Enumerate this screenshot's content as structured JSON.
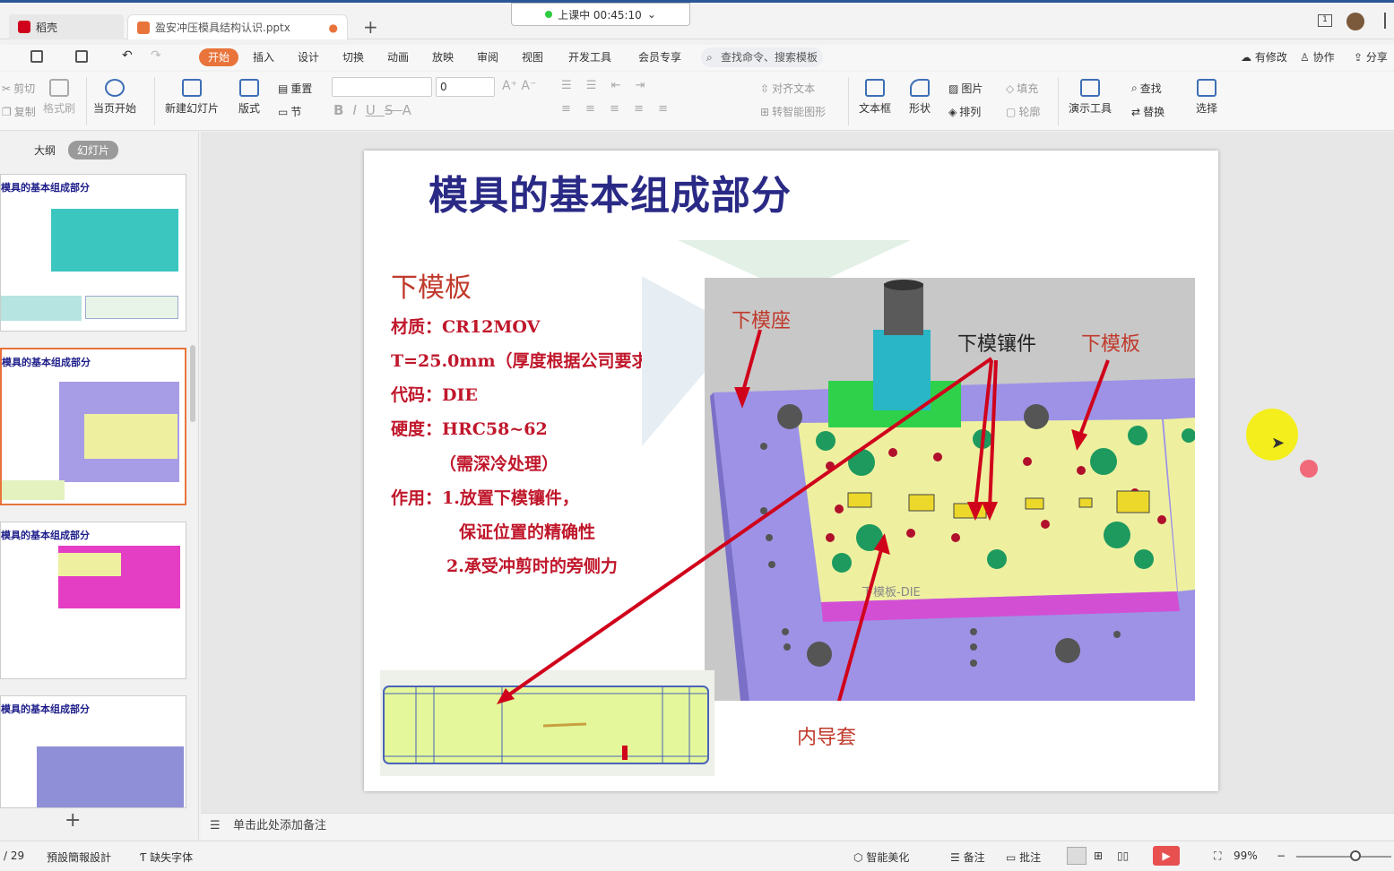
{
  "tabs": {
    "app": "稻壳",
    "file": "盈安冲压模具结构认识.pptx",
    "new_tab": "+"
  },
  "recording": {
    "status": "上课中 00:45:10"
  },
  "menu": {
    "items": [
      "开始",
      "插入",
      "设计",
      "切换",
      "动画",
      "放映",
      "审阅",
      "视图",
      "开发工具",
      "会员专享"
    ],
    "active": "开始",
    "search_placeholder": "查找命令、搜索模板",
    "right": [
      "有修改",
      "协作",
      "分享"
    ]
  },
  "ribbon": {
    "cut": "剪切",
    "copy": "复制",
    "format_painter": "格式刷",
    "start_from_current": "当页开始",
    "new_slide": "新建幻灯片",
    "layout": "版式",
    "reset": "重置",
    "section": "节",
    "font_size": "0",
    "align_text": "对齐文本",
    "convert_shape": "转智能图形",
    "textbox": "文本框",
    "shape": "形状",
    "picture": "图片",
    "fill": "填充",
    "arrange": "排列",
    "outline": "轮廓",
    "presentation_tools": "演示工具",
    "find": "查找",
    "replace": "替换",
    "select": "选择"
  },
  "panel": {
    "outline": "大纲",
    "slides": "幻灯片",
    "add": "+"
  },
  "thumbnails": [
    {
      "title": "模具的基本组成部分"
    },
    {
      "title": "模具的基本组成部分"
    },
    {
      "title": "模具的基本组成部分"
    },
    {
      "title": "模具的基本组成部分"
    }
  ],
  "slide": {
    "title": "模具的基本组成部分",
    "subheading": "下模板",
    "lines": [
      "材质：CR12MOV",
      "T=25.0mm（厚度根据公司要求）",
      "代码：DIE",
      "硬度：HRC58~62",
      "（需深冷处理）",
      "作用：1.放置下模镶件，",
      "保证位置的精确性",
      "2.承受冲剪时的旁侧力"
    ],
    "labels": {
      "lower_base": "下模座",
      "insert": "下模镶件",
      "plate": "下模板",
      "guide": "内导套",
      "plate_mark": "下模板-DIE"
    }
  },
  "notes": {
    "placeholder": "单击此处添加备注"
  },
  "status": {
    "page": "/ 29",
    "design": "預設簡報設計",
    "missing_font": "缺失字体",
    "beautify": "智能美化",
    "notes": "备注",
    "comments": "批注",
    "zoom": "99%"
  },
  "colors": {
    "accent": "#e8743b",
    "title": "#2a2a86",
    "red_text": "#c0172b",
    "arrow": "#d0021b",
    "plate_yellow": "#eef0a0",
    "base_purple": "#9b8fe0",
    "pin_cyan": "#29b6c6",
    "flange_green": "#2ecc40"
  }
}
